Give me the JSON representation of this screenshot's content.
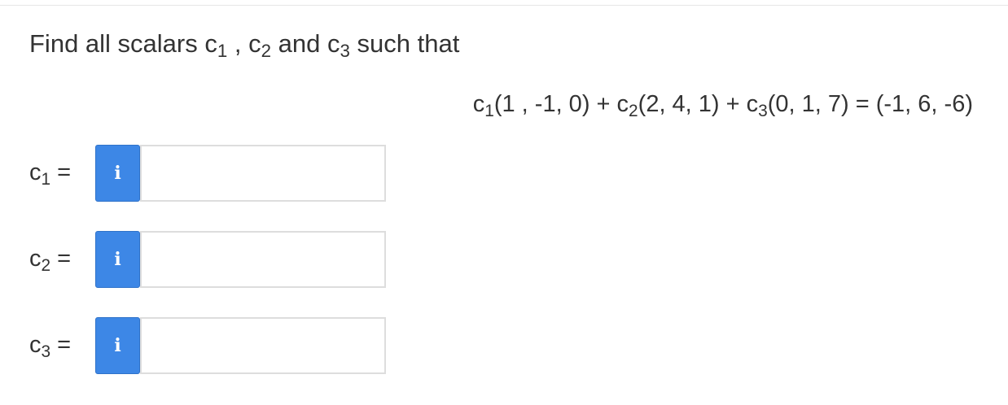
{
  "question": {
    "prefix": "Find all scalars ",
    "c1_var": "c",
    "c1_sub": "1",
    "sep1": " , ",
    "c2_var": "c",
    "c2_sub": "2",
    "and_text": " and ",
    "c3_var": "c",
    "c3_sub": "3",
    "suffix": " such that"
  },
  "equation": {
    "c1_var": "c",
    "c1_sub": "1",
    "v1": "(1 , -1, 0) + ",
    "c2_var": "c",
    "c2_sub": "2",
    "v2": "(2, 4, 1) + ",
    "c3_var": "c",
    "c3_sub": "3",
    "v3": "(0, 1, 7) = (-1, 6, -6)"
  },
  "answers": [
    {
      "var": "c",
      "sub": "1",
      "eq": " =",
      "info_label": "i",
      "value": "",
      "placeholder": ""
    },
    {
      "var": "c",
      "sub": "2",
      "eq": " =",
      "info_label": "i",
      "value": "",
      "placeholder": ""
    },
    {
      "var": "c",
      "sub": "3",
      "eq": " =",
      "info_label": "i",
      "value": "",
      "placeholder": ""
    }
  ],
  "colors": {
    "info_button": "#3d87e6",
    "text": "#333333",
    "input_border": "#dddddd"
  }
}
